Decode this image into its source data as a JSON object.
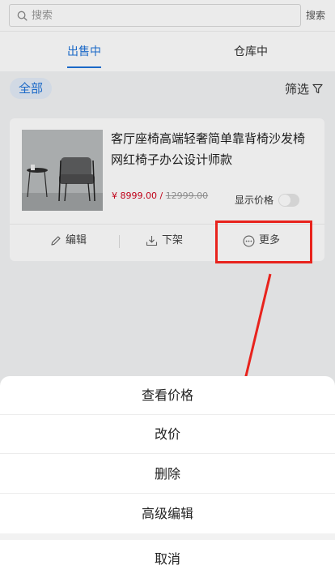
{
  "search": {
    "placeholder": "搜索",
    "button_label": "搜索"
  },
  "tabs": [
    {
      "label": "出售中",
      "active": true
    },
    {
      "label": "仓库中",
      "active": false
    }
  ],
  "filter": {
    "all_label": "全部",
    "filter_label": "筛选"
  },
  "product": {
    "title": "客厅座椅高端轻奢简单靠背椅沙发椅网红椅子办公设计师款",
    "price": "¥ 8999.00",
    "original_price": "12999.00",
    "show_price_label": "显示价格",
    "show_price_on": false
  },
  "card_actions": {
    "edit_label": "编辑",
    "off_shelf_label": "下架",
    "more_label": "更多"
  },
  "action_sheet": {
    "items": [
      "查看价格",
      "改价",
      "删除",
      "高级编辑"
    ],
    "cancel_label": "取消"
  },
  "colors": {
    "accent": "#1e72d8",
    "price": "#d0021b",
    "annotation": "#e8231d"
  }
}
